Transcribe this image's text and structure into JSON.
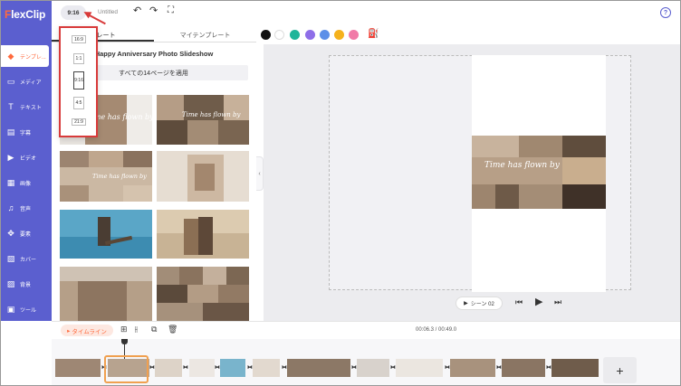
{
  "app": {
    "logo_first": "F",
    "logo_rest": "lexClip",
    "brand_color": "#5b5fcf",
    "accent_color": "#ff6a3d"
  },
  "topbar": {
    "ratio": "9:16",
    "doc_title": "Untitled",
    "undo_icon": "undo-icon",
    "redo_icon": "redo-icon",
    "fullscreen_icon": "fullscreen-icon",
    "help": "?"
  },
  "sidebar": {
    "items": [
      {
        "label": "テンプレ...",
        "icon": "template-icon",
        "glyph": "◆"
      },
      {
        "label": "メディア",
        "icon": "media-icon",
        "glyph": "▭"
      },
      {
        "label": "テキスト",
        "icon": "text-icon",
        "glyph": "T"
      },
      {
        "label": "字幕",
        "icon": "subtitle-icon",
        "glyph": "▤"
      },
      {
        "label": "ビデオ",
        "icon": "video-icon",
        "glyph": "▶"
      },
      {
        "label": "画像",
        "icon": "image-icon",
        "glyph": "▦"
      },
      {
        "label": "音声",
        "icon": "audio-icon",
        "glyph": "♫"
      },
      {
        "label": "要素",
        "icon": "elements-icon",
        "glyph": "✥"
      },
      {
        "label": "カバー",
        "icon": "cover-icon",
        "glyph": "▧"
      },
      {
        "label": "背景",
        "icon": "background-icon",
        "glyph": "▨"
      },
      {
        "label": "ツール",
        "icon": "tools-icon",
        "glyph": "▣"
      }
    ]
  },
  "panel": {
    "tabs": [
      "プレート",
      "マイテンプレート"
    ],
    "title": "Happy Anniversary Photo Slideshow",
    "apply_button": "すべての14ページを適用",
    "script_text": "Time has flown by"
  },
  "ratio_menu": {
    "options": [
      "16:9",
      "1:1",
      "9:16",
      "4:5",
      "21:9"
    ],
    "selected": "9:16"
  },
  "colors": {
    "swatches": [
      "#111111",
      "#ffffff",
      "#1fb59a",
      "#8e6ee8",
      "#5b8fe8",
      "#f5b21c",
      "#f17aa7"
    ]
  },
  "playback": {
    "scene_label": "シーン 02",
    "play_glyph": "▶",
    "prev_glyph": "⏮",
    "next_glyph": "⏭"
  },
  "timeline": {
    "label": "タイムライン",
    "timecode": "00:06.3 / 00:49.0",
    "add": "+"
  }
}
